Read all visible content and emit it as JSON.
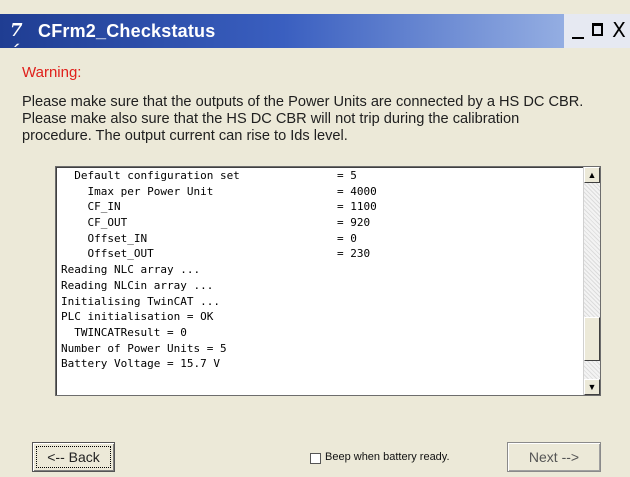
{
  "window": {
    "title": "CFrm2_Checkstatus",
    "icon_glyph": "7´",
    "controls": {
      "minimize": "_",
      "maximize": "□",
      "close": "X"
    }
  },
  "warning": {
    "heading": "Warning:",
    "lines": [
      "Please make sure that the outputs of the Power Units are connected by a HS DC CBR.",
      "Please make also sure that the HS DC CBR will not trip during the calibration",
      "procedure. The output current can rise to Ids level."
    ]
  },
  "log": {
    "lines": [
      {
        "key": "  Default configuration set",
        "value": "= 5"
      },
      {
        "key": "    Imax per Power Unit",
        "value": "= 4000"
      },
      {
        "key": "    CF_IN",
        "value": "= 1100"
      },
      {
        "key": "    CF_OUT",
        "value": "= 920"
      },
      {
        "key": "    Offset_IN",
        "value": "= 0"
      },
      {
        "key": "    Offset_OUT",
        "value": "= 230"
      },
      {
        "key": "Reading NLC array ...",
        "value": ""
      },
      {
        "key": "Reading NLCin array ...",
        "value": ""
      },
      {
        "key": "Initialising TwinCAT ...",
        "value": ""
      },
      {
        "key": "PLC initialisation = OK",
        "value": ""
      },
      {
        "key": "  TWINCATResult = 0",
        "value": ""
      },
      {
        "key": "Number of Power Units = 5",
        "value": ""
      },
      {
        "key": "Battery Voltage = 15.7 V",
        "value": ""
      }
    ],
    "scrollbar": {
      "position_fraction": 0.88
    }
  },
  "footer": {
    "back_label": "<-- Back",
    "next_label": "Next -->",
    "beep_checkbox_label": "Beep when battery ready.",
    "beep_checked": false
  },
  "colors": {
    "titlebar_start": "#1f3d92",
    "titlebar_end": "#a9c0ea",
    "warning": "#e0201b",
    "window_bg": "#ece9d8"
  }
}
